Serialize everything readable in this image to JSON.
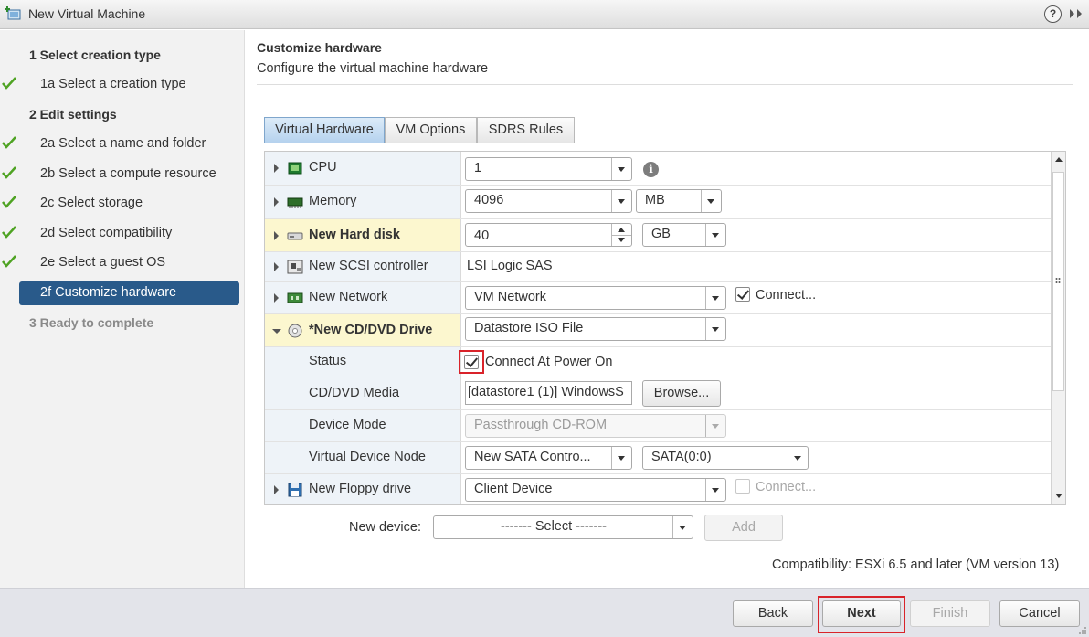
{
  "window": {
    "title": "New Virtual Machine"
  },
  "steps": [
    {
      "label": "1  Select creation type",
      "kind": "header",
      "done": false
    },
    {
      "label": "1a  Select a creation type",
      "kind": "sub",
      "done": true
    },
    {
      "label": "2  Edit settings",
      "kind": "header",
      "done": false
    },
    {
      "label": "2a  Select a name and folder",
      "kind": "sub",
      "done": true
    },
    {
      "label": "2b  Select a compute resource",
      "kind": "sub",
      "done": true
    },
    {
      "label": "2c  Select storage",
      "kind": "sub",
      "done": true
    },
    {
      "label": "2d  Select compatibility",
      "kind": "sub",
      "done": true
    },
    {
      "label": "2e  Select a guest OS",
      "kind": "sub",
      "done": true
    },
    {
      "label": "2f  Customize hardware",
      "kind": "active",
      "done": false
    },
    {
      "label": "3  Ready to complete",
      "kind": "pending",
      "done": false
    }
  ],
  "main": {
    "heading": "Customize hardware",
    "subheading": "Configure the virtual machine hardware"
  },
  "tabs": [
    "Virtual Hardware",
    "VM Options",
    "SDRS Rules"
  ],
  "hardware": {
    "cpu": {
      "label": "CPU",
      "value": "1"
    },
    "memory": {
      "label": "Memory",
      "value": "4096",
      "unit": "MB"
    },
    "hard_disk": {
      "label": "New Hard disk",
      "value": "40",
      "unit": "GB"
    },
    "scsi": {
      "label": "New SCSI controller",
      "value": "LSI Logic SAS"
    },
    "network": {
      "label": "New Network",
      "value": "VM Network",
      "connect_label": "Connect..."
    },
    "cd_drive": {
      "label": "*New CD/DVD Drive",
      "value": "Datastore ISO File"
    },
    "status": {
      "label": "Status",
      "checkbox_label": "Connect At Power On"
    },
    "cd_media": {
      "label": "CD/DVD Media",
      "value": "[datastore1 (1)] WindowsS",
      "browse": "Browse..."
    },
    "device_mode": {
      "label": "Device Mode",
      "value": "Passthrough CD-ROM"
    },
    "vdn": {
      "label": "Virtual Device Node",
      "controller": "New SATA Contro...",
      "node": "SATA(0:0)"
    },
    "floppy": {
      "label": "New Floppy drive",
      "value": "Client Device",
      "connect_label": "Connect..."
    }
  },
  "new_device": {
    "label": "New device:",
    "select": "------- Select -------",
    "add": "Add"
  },
  "compatibility": "Compatibility: ESXi 6.5 and later (VM version 13)",
  "footer": {
    "back": "Back",
    "next": "Next",
    "finish": "Finish",
    "cancel": "Cancel"
  },
  "colors": {
    "accent": "#295a8a",
    "check": "#4fa323",
    "highlight_box": "#d9232a"
  }
}
